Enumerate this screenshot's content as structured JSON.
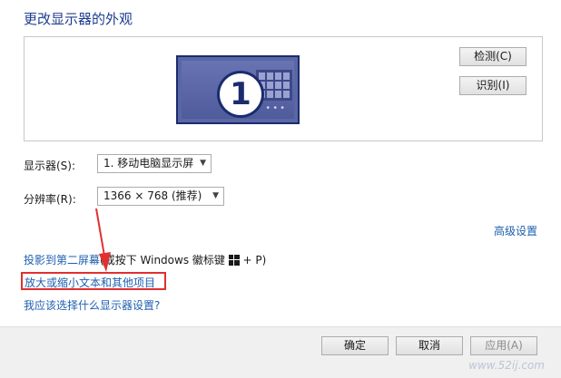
{
  "title": "更改显示器的外观",
  "preview": {
    "monitor_number": "1",
    "dots": "•••",
    "detect_label": "检测(C)",
    "identify_label": "识别(I)"
  },
  "display": {
    "label": "显示器(S):",
    "value": "1. 移动电脑显示屏"
  },
  "resolution": {
    "label": "分辨率(R):",
    "value": "1366 × 768 (推荐)"
  },
  "links": {
    "advanced": "高级设置",
    "project_link": "投影到第二屏幕",
    "project_rest": "(或按下 Windows 徽标键 ",
    "project_tail": " + P)",
    "enlarge": "放大或缩小文本和其他项目",
    "which_settings": "我应该选择什么显示器设置?"
  },
  "footer": {
    "ok_label": "确定",
    "cancel_label": "取消",
    "apply_label": "应用(A)",
    "watermark": "www.52ij.com"
  },
  "colors": {
    "highlight_box": "#e03030",
    "link": "#1e5fb0",
    "title": "#1e3d8f"
  }
}
